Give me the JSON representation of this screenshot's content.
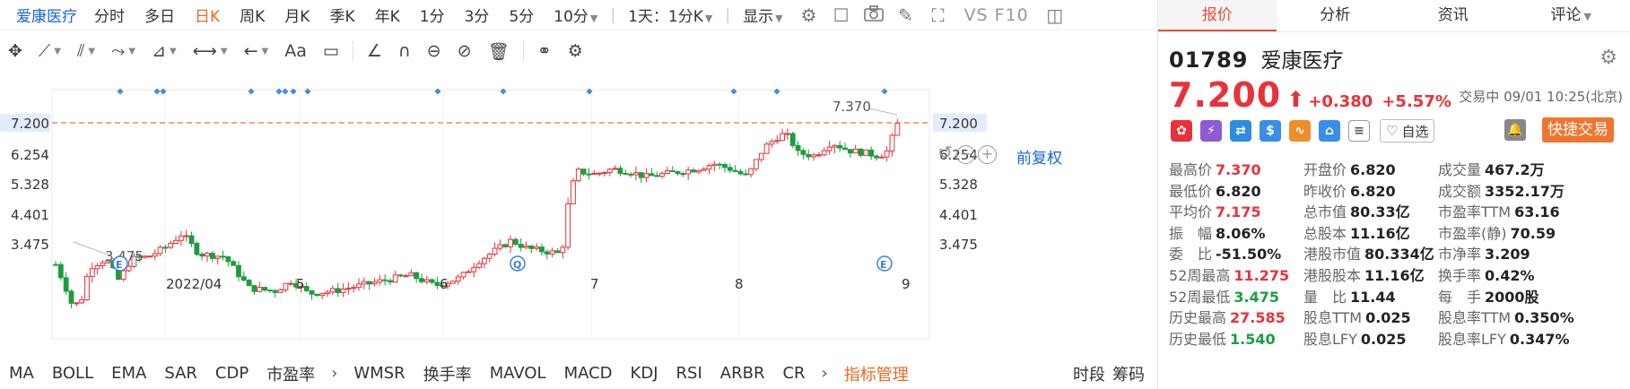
{
  "period_bar": {
    "stock_title": "爱康医疗",
    "periods": [
      "分时",
      "多日",
      "日K",
      "周K",
      "月K",
      "季K",
      "年K",
      "1分",
      "3分",
      "5分",
      "10分"
    ],
    "active_period": "日K",
    "combo_label": "1天：1分K",
    "display_label": "显示",
    "vs_label": "VS F10"
  },
  "draw_bar": {
    "text_tool_label": "Aa"
  },
  "chart": {
    "adjust_label": "前复权",
    "price_labels": [
      "7.200",
      "6.254",
      "5.328",
      "4.401",
      "3.475"
    ],
    "current_price_label": "7.200",
    "high_annotation": "7.370",
    "low_annotation": "3.475",
    "x_labels": [
      "2022/04",
      "5",
      "6",
      "7",
      "8",
      "9"
    ],
    "event_markers": [
      "E",
      "Q",
      "E"
    ]
  },
  "chart_data": {
    "type": "candlestick",
    "x_ticks": [
      "2022/04",
      "5",
      "6",
      "7",
      "8",
      "9"
    ],
    "y_ticks": [
      7.2,
      6.254,
      5.328,
      4.401,
      3.475
    ],
    "ylim": [
      3.0,
      7.6
    ],
    "current_price": 7.2,
    "max_marker": 7.37,
    "min_marker": 3.475
  },
  "indicators": {
    "items": [
      "MA",
      "BOLL",
      "EMA",
      "SAR",
      "CDP",
      "市盈率",
      "WMSR",
      "换手率",
      "MAVOL",
      "MACD",
      "KDJ",
      "RSI",
      "ARBR",
      "CR"
    ],
    "manage_label": "指标管理",
    "right_items": [
      "时段",
      "筹码"
    ]
  },
  "panel": {
    "tabs": [
      "报价",
      "分析",
      "资讯",
      "评论"
    ],
    "active_tab": "报价",
    "code": "01789",
    "name": "爱康医疗",
    "price": "7.200",
    "change": "+0.380",
    "change_pct": "+5.57%",
    "status": "交易中 09/01 10:25(北京)",
    "watch_label": "自选",
    "trade_label": "快捷交易",
    "quote_rows": [
      [
        {
          "k": "最高价",
          "v": "7.370",
          "c": "red"
        },
        {
          "k": "开盘价",
          "v": "6.820",
          "c": "dark"
        },
        {
          "k": "成交量",
          "v": "467.2万",
          "c": "dark"
        }
      ],
      [
        {
          "k": "最低价",
          "v": "6.820",
          "c": "dark"
        },
        {
          "k": "昨收价",
          "v": "6.820",
          "c": "dark"
        },
        {
          "k": "成交额",
          "v": "3352.17万",
          "c": "dark"
        }
      ],
      [
        {
          "k": "平均价",
          "v": "7.175",
          "c": "red"
        },
        {
          "k": "总市值",
          "v": "80.33亿",
          "c": "dark"
        },
        {
          "k": "市盈率TTM",
          "v": "63.16",
          "c": "dark"
        }
      ],
      [
        {
          "k": "振　幅",
          "v": "8.06%",
          "c": "dark"
        },
        {
          "k": "总股本",
          "v": "11.16亿",
          "c": "dark"
        },
        {
          "k": "市盈率(静)",
          "v": "70.59",
          "c": "dark"
        }
      ],
      [
        {
          "k": "委　比",
          "v": "-51.50%",
          "c": "dark"
        },
        {
          "k": "港股市值",
          "v": "80.334亿",
          "c": "dark"
        },
        {
          "k": "市净率",
          "v": "3.209",
          "c": "dark"
        }
      ],
      [
        {
          "k": "52周最高",
          "v": "11.275",
          "c": "red"
        },
        {
          "k": "港股股本",
          "v": "11.16亿",
          "c": "dark"
        },
        {
          "k": "换手率",
          "v": "0.42%",
          "c": "dark"
        }
      ],
      [
        {
          "k": "52周最低",
          "v": "3.475",
          "c": "green"
        },
        {
          "k": "量　比",
          "v": "11.44",
          "c": "dark"
        },
        {
          "k": "每　手",
          "v": "2000股",
          "c": "dark"
        }
      ],
      [
        {
          "k": "历史最高",
          "v": "27.585",
          "c": "red"
        },
        {
          "k": "股息TTM",
          "v": "0.025",
          "c": "dark"
        },
        {
          "k": "股息率TTM",
          "v": "0.350%",
          "c": "dark"
        }
      ],
      [
        {
          "k": "历史最低",
          "v": "1.540",
          "c": "green"
        },
        {
          "k": "股息LFY",
          "v": "0.025",
          "c": "dark"
        },
        {
          "k": "股息率LFY",
          "v": "0.347%",
          "c": "dark"
        }
      ]
    ]
  },
  "colors": {
    "up": "#e8323a",
    "down": "#1b9e3e",
    "accent": "#f06820",
    "link": "#1a64d8"
  }
}
